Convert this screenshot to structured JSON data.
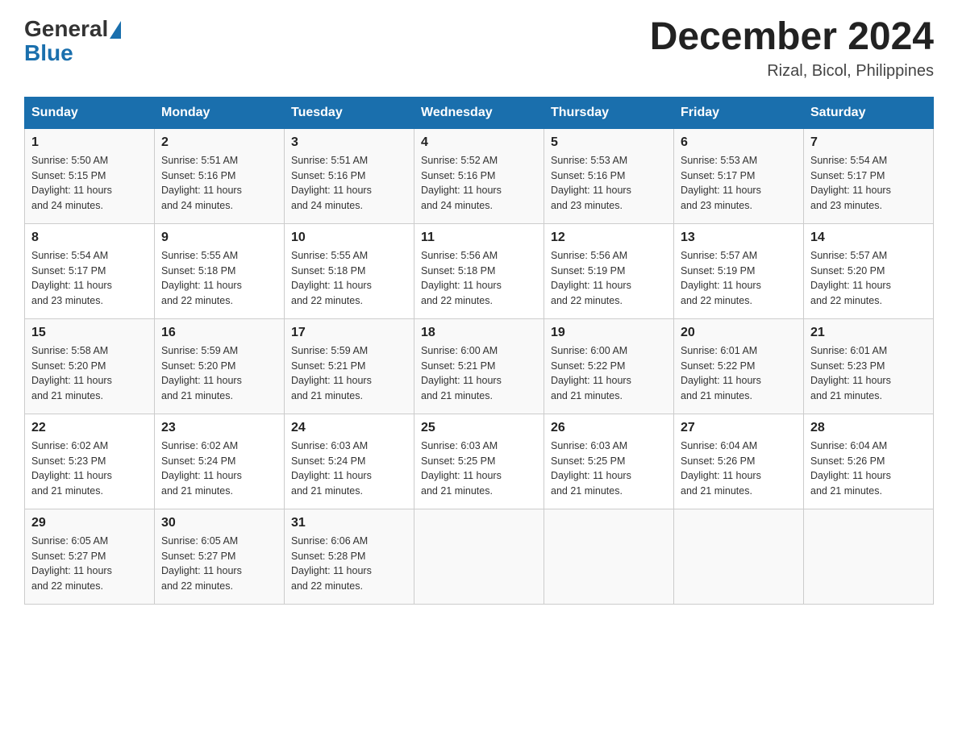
{
  "header": {
    "logo_general": "General",
    "logo_blue": "Blue",
    "month_title": "December 2024",
    "location": "Rizal, Bicol, Philippines"
  },
  "days_of_week": [
    "Sunday",
    "Monday",
    "Tuesday",
    "Wednesday",
    "Thursday",
    "Friday",
    "Saturday"
  ],
  "weeks": [
    [
      {
        "day": "1",
        "sunrise": "5:50 AM",
        "sunset": "5:15 PM",
        "daylight": "11 hours and 24 minutes."
      },
      {
        "day": "2",
        "sunrise": "5:51 AM",
        "sunset": "5:16 PM",
        "daylight": "11 hours and 24 minutes."
      },
      {
        "day": "3",
        "sunrise": "5:51 AM",
        "sunset": "5:16 PM",
        "daylight": "11 hours and 24 minutes."
      },
      {
        "day": "4",
        "sunrise": "5:52 AM",
        "sunset": "5:16 PM",
        "daylight": "11 hours and 24 minutes."
      },
      {
        "day": "5",
        "sunrise": "5:53 AM",
        "sunset": "5:16 PM",
        "daylight": "11 hours and 23 minutes."
      },
      {
        "day": "6",
        "sunrise": "5:53 AM",
        "sunset": "5:17 PM",
        "daylight": "11 hours and 23 minutes."
      },
      {
        "day": "7",
        "sunrise": "5:54 AM",
        "sunset": "5:17 PM",
        "daylight": "11 hours and 23 minutes."
      }
    ],
    [
      {
        "day": "8",
        "sunrise": "5:54 AM",
        "sunset": "5:17 PM",
        "daylight": "11 hours and 23 minutes."
      },
      {
        "day": "9",
        "sunrise": "5:55 AM",
        "sunset": "5:18 PM",
        "daylight": "11 hours and 22 minutes."
      },
      {
        "day": "10",
        "sunrise": "5:55 AM",
        "sunset": "5:18 PM",
        "daylight": "11 hours and 22 minutes."
      },
      {
        "day": "11",
        "sunrise": "5:56 AM",
        "sunset": "5:18 PM",
        "daylight": "11 hours and 22 minutes."
      },
      {
        "day": "12",
        "sunrise": "5:56 AM",
        "sunset": "5:19 PM",
        "daylight": "11 hours and 22 minutes."
      },
      {
        "day": "13",
        "sunrise": "5:57 AM",
        "sunset": "5:19 PM",
        "daylight": "11 hours and 22 minutes."
      },
      {
        "day": "14",
        "sunrise": "5:57 AM",
        "sunset": "5:20 PM",
        "daylight": "11 hours and 22 minutes."
      }
    ],
    [
      {
        "day": "15",
        "sunrise": "5:58 AM",
        "sunset": "5:20 PM",
        "daylight": "11 hours and 21 minutes."
      },
      {
        "day": "16",
        "sunrise": "5:59 AM",
        "sunset": "5:20 PM",
        "daylight": "11 hours and 21 minutes."
      },
      {
        "day": "17",
        "sunrise": "5:59 AM",
        "sunset": "5:21 PM",
        "daylight": "11 hours and 21 minutes."
      },
      {
        "day": "18",
        "sunrise": "6:00 AM",
        "sunset": "5:21 PM",
        "daylight": "11 hours and 21 minutes."
      },
      {
        "day": "19",
        "sunrise": "6:00 AM",
        "sunset": "5:22 PM",
        "daylight": "11 hours and 21 minutes."
      },
      {
        "day": "20",
        "sunrise": "6:01 AM",
        "sunset": "5:22 PM",
        "daylight": "11 hours and 21 minutes."
      },
      {
        "day": "21",
        "sunrise": "6:01 AM",
        "sunset": "5:23 PM",
        "daylight": "11 hours and 21 minutes."
      }
    ],
    [
      {
        "day": "22",
        "sunrise": "6:02 AM",
        "sunset": "5:23 PM",
        "daylight": "11 hours and 21 minutes."
      },
      {
        "day": "23",
        "sunrise": "6:02 AM",
        "sunset": "5:24 PM",
        "daylight": "11 hours and 21 minutes."
      },
      {
        "day": "24",
        "sunrise": "6:03 AM",
        "sunset": "5:24 PM",
        "daylight": "11 hours and 21 minutes."
      },
      {
        "day": "25",
        "sunrise": "6:03 AM",
        "sunset": "5:25 PM",
        "daylight": "11 hours and 21 minutes."
      },
      {
        "day": "26",
        "sunrise": "6:03 AM",
        "sunset": "5:25 PM",
        "daylight": "11 hours and 21 minutes."
      },
      {
        "day": "27",
        "sunrise": "6:04 AM",
        "sunset": "5:26 PM",
        "daylight": "11 hours and 21 minutes."
      },
      {
        "day": "28",
        "sunrise": "6:04 AM",
        "sunset": "5:26 PM",
        "daylight": "11 hours and 21 minutes."
      }
    ],
    [
      {
        "day": "29",
        "sunrise": "6:05 AM",
        "sunset": "5:27 PM",
        "daylight": "11 hours and 22 minutes."
      },
      {
        "day": "30",
        "sunrise": "6:05 AM",
        "sunset": "5:27 PM",
        "daylight": "11 hours and 22 minutes."
      },
      {
        "day": "31",
        "sunrise": "6:06 AM",
        "sunset": "5:28 PM",
        "daylight": "11 hours and 22 minutes."
      },
      null,
      null,
      null,
      null
    ]
  ],
  "labels": {
    "sunrise": "Sunrise:",
    "sunset": "Sunset:",
    "daylight": "Daylight:"
  },
  "colors": {
    "header_bg": "#1a6fad",
    "header_text": "#ffffff",
    "border": "#cccccc"
  }
}
